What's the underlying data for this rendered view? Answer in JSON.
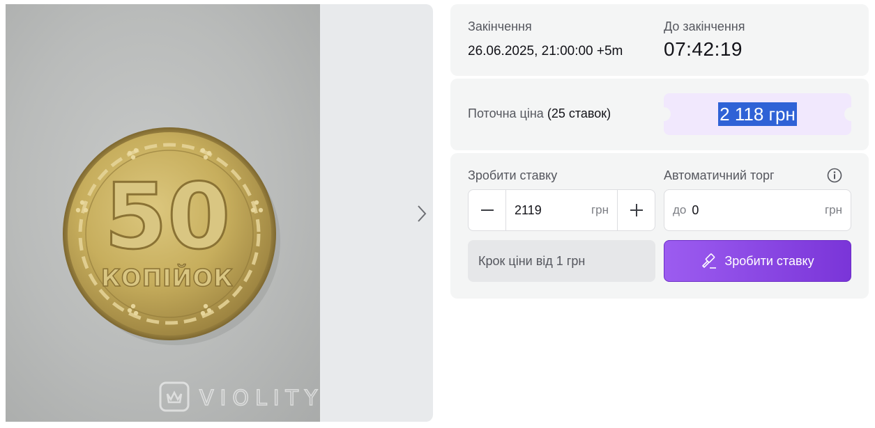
{
  "gallery": {
    "coin": {
      "denomination": "50",
      "word": "КОПІЙОК"
    },
    "watermark": "VIOLITY",
    "next_icon": "chevron-right-icon"
  },
  "auction": {
    "end": {
      "label": "Закінчення",
      "value": "26.06.2025, 21:00:00 +5m"
    },
    "countdown": {
      "label": "До закінчення",
      "value": "07:42:19"
    },
    "price": {
      "label": "Поточна ціна",
      "bids": "(25 ставок)",
      "amount": "2 118 грн"
    },
    "bid": {
      "label": "Зробити ставку",
      "value": "2119",
      "unit": "грн",
      "minus_icon": "minus-icon",
      "plus_icon": "plus-icon"
    },
    "auto": {
      "label": "Автоматичний торг",
      "prefix": "до",
      "value": "0",
      "unit": "грн",
      "info_icon": "info-icon"
    },
    "step": {
      "text": "Крок ціни від 1 грн"
    },
    "submit": {
      "label": "Зробити ставку",
      "icon": "gavel-icon"
    }
  },
  "colors": {
    "accent": "#8a46e6",
    "price_highlight": "#2f62d6",
    "price_bg": "#f1e8fd",
    "card_bg": "#f4f5f5"
  }
}
